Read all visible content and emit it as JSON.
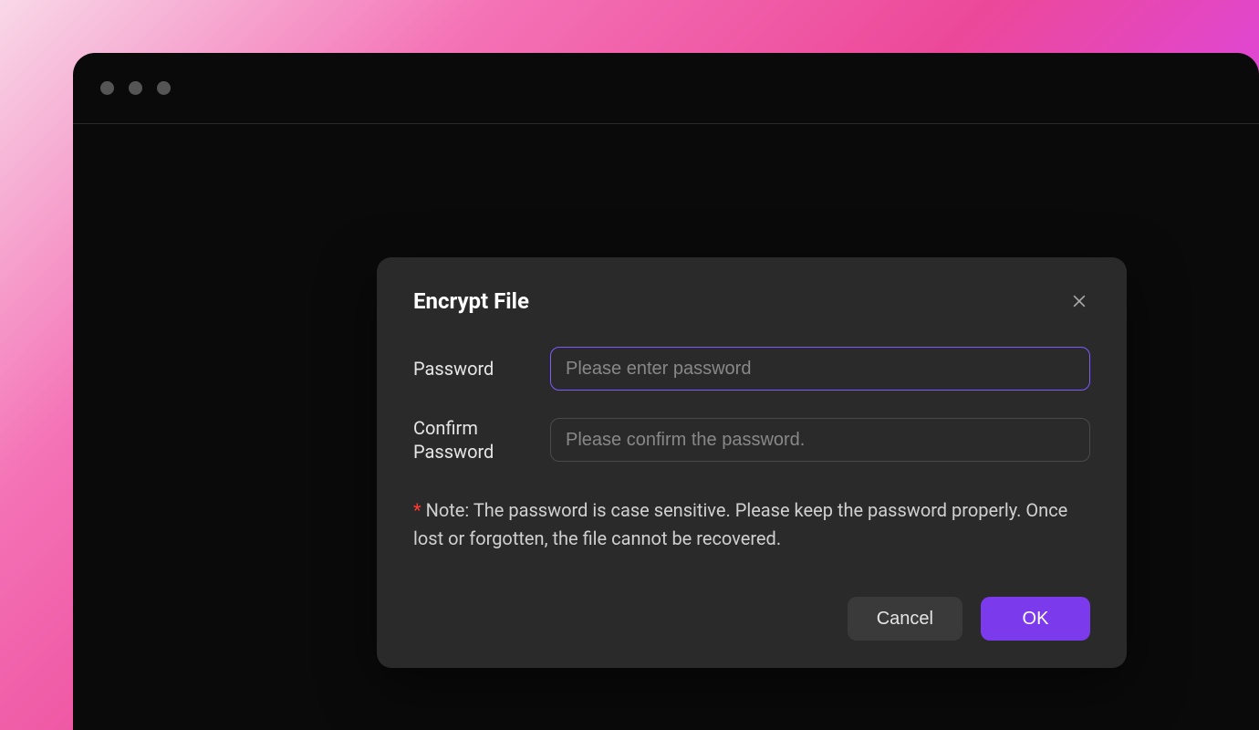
{
  "dialog": {
    "title": "Encrypt File",
    "password_label": "Password",
    "password_placeholder": "Please enter password",
    "confirm_label": "Confirm Password",
    "confirm_placeholder": "Please confirm the password.",
    "note_asterisk": "*",
    "note_text": " Note: The password is case sensitive. Please keep the password properly. Once lost or forgotten, the file cannot be recovered.",
    "cancel_label": "Cancel",
    "ok_label": "OK"
  }
}
